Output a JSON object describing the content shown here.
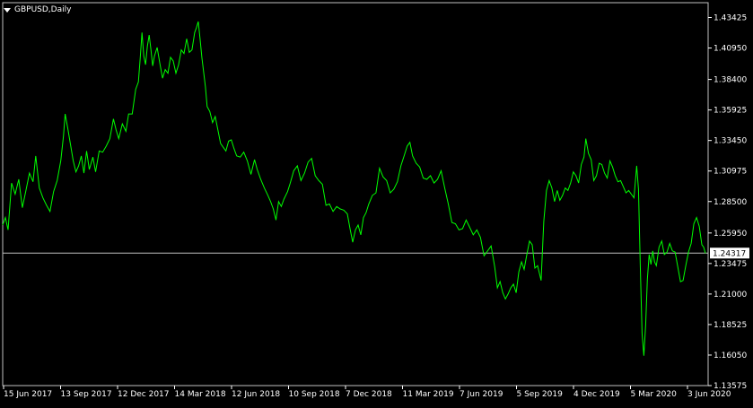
{
  "chart_data": {
    "type": "line",
    "title": "GBPUSD,Daily",
    "symbol": "GBPUSD",
    "timeframe": "Daily",
    "colors": {
      "background": "#000000",
      "line": "#00ff00",
      "axis": "#ffffff",
      "bid_line": "#c0c0c0"
    },
    "ylim": [
      1.13575,
      1.44625
    ],
    "y_ticks": [
      "1.43425",
      "1.40950",
      "1.38400",
      "1.35925",
      "1.33450",
      "1.30975",
      "1.28500",
      "1.25950",
      "1.23475",
      "1.21000",
      "1.18525",
      "1.16050",
      "1.13575"
    ],
    "x_ticks": [
      "15 Jun 2017",
      "13 Sep 2017",
      "12 Dec 2017",
      "14 Mar 2018",
      "12 Jun 2018",
      "10 Sep 2018",
      "7 Dec 2018",
      "11 Mar 2019",
      "7 Jun 2019",
      "5 Sep 2019",
      "4 Dec 2019",
      "5 Mar 2020",
      "3 Jun 2020"
    ],
    "current_price": "1.24317",
    "current_price_value": 1.24317,
    "series": [
      {
        "values": [
          [
            0,
            1.266
          ],
          [
            3,
            1.272
          ],
          [
            6,
            1.262
          ],
          [
            10,
            1.3
          ],
          [
            14,
            1.291
          ],
          [
            18,
            1.303
          ],
          [
            22,
            1.28
          ],
          [
            26,
            1.294
          ],
          [
            30,
            1.308
          ],
          [
            34,
            1.301
          ],
          [
            37,
            1.322
          ],
          [
            41,
            1.296
          ],
          [
            45,
            1.288
          ],
          [
            49,
            1.282
          ],
          [
            53,
            1.277
          ],
          [
            57,
            1.293
          ],
          [
            61,
            1.302
          ],
          [
            65,
            1.318
          ],
          [
            68,
            1.338
          ],
          [
            70,
            1.356
          ],
          [
            73,
            1.344
          ],
          [
            76,
            1.331
          ],
          [
            79,
            1.318
          ],
          [
            82,
            1.309
          ],
          [
            85,
            1.314
          ],
          [
            88,
            1.322
          ],
          [
            91,
            1.308
          ],
          [
            94,
            1.326
          ],
          [
            97,
            1.311
          ],
          [
            101,
            1.321
          ],
          [
            104,
            1.309
          ],
          [
            108,
            1.326
          ],
          [
            112,
            1.325
          ],
          [
            116,
            1.33
          ],
          [
            120,
            1.336
          ],
          [
            124,
            1.352
          ],
          [
            127,
            1.343
          ],
          [
            130,
            1.336
          ],
          [
            134,
            1.348
          ],
          [
            138,
            1.342
          ],
          [
            141,
            1.356
          ],
          [
            145,
            1.356
          ],
          [
            149,
            1.376
          ],
          [
            152,
            1.382
          ],
          [
            154,
            1.401
          ],
          [
            156,
            1.422
          ],
          [
            158,
            1.403
          ],
          [
            160,
            1.396
          ],
          [
            162,
            1.411
          ],
          [
            164,
            1.42
          ],
          [
            166,
            1.408
          ],
          [
            168,
            1.395
          ],
          [
            170,
            1.403
          ],
          [
            173,
            1.41
          ],
          [
            176,
            1.397
          ],
          [
            179,
            1.385
          ],
          [
            182,
            1.392
          ],
          [
            185,
            1.389
          ],
          [
            188,
            1.402
          ],
          [
            191,
            1.399
          ],
          [
            194,
            1.389
          ],
          [
            197,
            1.396
          ],
          [
            200,
            1.408
          ],
          [
            203,
            1.405
          ],
          [
            206,
            1.417
          ],
          [
            209,
            1.406
          ],
          [
            212,
            1.408
          ],
          [
            215,
            1.422
          ],
          [
            217,
            1.426
          ],
          [
            219,
            1.431
          ],
          [
            221,
            1.417
          ],
          [
            223,
            1.402
          ],
          [
            225,
            1.39
          ],
          [
            227,
            1.378
          ],
          [
            229,
            1.362
          ],
          [
            232,
            1.358
          ],
          [
            235,
            1.349
          ],
          [
            238,
            1.354
          ],
          [
            241,
            1.343
          ],
          [
            244,
            1.332
          ],
          [
            247,
            1.329
          ],
          [
            250,
            1.326
          ],
          [
            253,
            1.334
          ],
          [
            256,
            1.335
          ],
          [
            259,
            1.328
          ],
          [
            262,
            1.322
          ],
          [
            266,
            1.321
          ],
          [
            270,
            1.325
          ],
          [
            274,
            1.318
          ],
          [
            278,
            1.307
          ],
          [
            282,
            1.319
          ],
          [
            285,
            1.311
          ],
          [
            289,
            1.303
          ],
          [
            293,
            1.296
          ],
          [
            297,
            1.29
          ],
          [
            300,
            1.285
          ],
          [
            303,
            1.279
          ],
          [
            306,
            1.27
          ],
          [
            309,
            1.285
          ],
          [
            312,
            1.281
          ],
          [
            315,
            1.287
          ],
          [
            319,
            1.293
          ],
          [
            322,
            1.3
          ],
          [
            326,
            1.31
          ],
          [
            330,
            1.314
          ],
          [
            334,
            1.302
          ],
          [
            338,
            1.308
          ],
          [
            342,
            1.317
          ],
          [
            346,
            1.32
          ],
          [
            350,
            1.306
          ],
          [
            354,
            1.302
          ],
          [
            358,
            1.299
          ],
          [
            362,
            1.282
          ],
          [
            366,
            1.283
          ],
          [
            370,
            1.277
          ],
          [
            374,
            1.281
          ],
          [
            378,
            1.279
          ],
          [
            382,
            1.278
          ],
          [
            386,
            1.275
          ],
          [
            389,
            1.263
          ],
          [
            392,
            1.252
          ],
          [
            395,
            1.262
          ],
          [
            398,
            1.266
          ],
          [
            401,
            1.258
          ],
          [
            404,
            1.272
          ],
          [
            407,
            1.276
          ],
          [
            410,
            1.283
          ],
          [
            414,
            1.29
          ],
          [
            418,
            1.292
          ],
          [
            422,
            1.312
          ],
          [
            426,
            1.305
          ],
          [
            430,
            1.302
          ],
          [
            434,
            1.292
          ],
          [
            438,
            1.295
          ],
          [
            442,
            1.301
          ],
          [
            446,
            1.314
          ],
          [
            450,
            1.323
          ],
          [
            453,
            1.33
          ],
          [
            456,
            1.333
          ],
          [
            459,
            1.322
          ],
          [
            463,
            1.316
          ],
          [
            467,
            1.313
          ],
          [
            471,
            1.304
          ],
          [
            475,
            1.303
          ],
          [
            479,
            1.306
          ],
          [
            483,
            1.3
          ],
          [
            487,
            1.303
          ],
          [
            491,
            1.31
          ],
          [
            495,
            1.296
          ],
          [
            499,
            1.283
          ],
          [
            503,
            1.268
          ],
          [
            507,
            1.267
          ],
          [
            511,
            1.262
          ],
          [
            515,
            1.263
          ],
          [
            519,
            1.27
          ],
          [
            523,
            1.264
          ],
          [
            527,
            1.258
          ],
          [
            531,
            1.262
          ],
          [
            535,
            1.256
          ],
          [
            539,
            1.241
          ],
          [
            543,
            1.245
          ],
          [
            547,
            1.249
          ],
          [
            551,
            1.232
          ],
          [
            554,
            1.215
          ],
          [
            557,
            1.22
          ],
          [
            560,
            1.211
          ],
          [
            563,
            1.206
          ],
          [
            566,
            1.21
          ],
          [
            569,
            1.215
          ],
          [
            572,
            1.218
          ],
          [
            575,
            1.211
          ],
          [
            578,
            1.228
          ],
          [
            581,
            1.236
          ],
          [
            584,
            1.23
          ],
          [
            587,
            1.242
          ],
          [
            590,
            1.253
          ],
          [
            593,
            1.25
          ],
          [
            596,
            1.231
          ],
          [
            599,
            1.233
          ],
          [
            603,
            1.221
          ],
          [
            606,
            1.269
          ],
          [
            609,
            1.294
          ],
          [
            612,
            1.302
          ],
          [
            615,
            1.296
          ],
          [
            618,
            1.285
          ],
          [
            621,
            1.294
          ],
          [
            624,
            1.286
          ],
          [
            627,
            1.29
          ],
          [
            630,
            1.296
          ],
          [
            633,
            1.294
          ],
          [
            636,
            1.3
          ],
          [
            639,
            1.309
          ],
          [
            642,
            1.306
          ],
          [
            645,
            1.3
          ],
          [
            648,
            1.315
          ],
          [
            651,
            1.321
          ],
          [
            653,
            1.336
          ],
          [
            656,
            1.324
          ],
          [
            659,
            1.319
          ],
          [
            662,
            1.302
          ],
          [
            665,
            1.306
          ],
          [
            668,
            1.316
          ],
          [
            671,
            1.315
          ],
          [
            674,
            1.308
          ],
          [
            677,
            1.304
          ],
          [
            680,
            1.318
          ],
          [
            683,
            1.313
          ],
          [
            686,
            1.306
          ],
          [
            689,
            1.301
          ],
          [
            692,
            1.302
          ],
          [
            695,
            1.297
          ],
          [
            698,
            1.292
          ],
          [
            701,
            1.294
          ],
          [
            704,
            1.291
          ],
          [
            707,
            1.288
          ],
          [
            710,
            1.314
          ],
          [
            712,
            1.295
          ],
          [
            714,
            1.233
          ],
          [
            716,
            1.178
          ],
          [
            718,
            1.16
          ],
          [
            720,
            1.185
          ],
          [
            722,
            1.222
          ],
          [
            724,
            1.242
          ],
          [
            726,
            1.234
          ],
          [
            728,
            1.245
          ],
          [
            730,
            1.236
          ],
          [
            732,
            1.233
          ],
          [
            735,
            1.248
          ],
          [
            738,
            1.253
          ],
          [
            741,
            1.242
          ],
          [
            744,
            1.244
          ],
          [
            747,
            1.251
          ],
          [
            750,
            1.245
          ],
          [
            753,
            1.244
          ],
          [
            756,
            1.232
          ],
          [
            759,
            1.22
          ],
          [
            762,
            1.221
          ],
          [
            765,
            1.233
          ],
          [
            768,
            1.244
          ],
          [
            771,
            1.251
          ],
          [
            774,
            1.267
          ],
          [
            777,
            1.272
          ],
          [
            780,
            1.265
          ],
          [
            783,
            1.25
          ],
          [
            785,
            1.248
          ],
          [
            787,
            1.243
          ]
        ]
      }
    ]
  }
}
